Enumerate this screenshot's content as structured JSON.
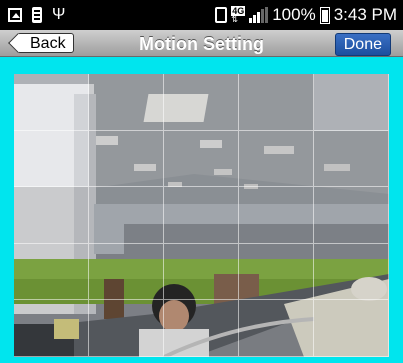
{
  "status_bar": {
    "battery": "100%",
    "time": "3:43 PM",
    "network": "4G",
    "icons": [
      "gallery-icon",
      "sd-card-icon",
      "usb-icon",
      "vibrate-icon",
      "lte-icon",
      "signal-icon",
      "battery-icon"
    ]
  },
  "nav": {
    "back_label": "Back",
    "title": "Motion Setting",
    "done_label": "Done"
  },
  "motion_grid": {
    "columns": 5,
    "rows": 5,
    "cells": [
      [
        false,
        true,
        true,
        true,
        false
      ],
      [
        false,
        true,
        true,
        true,
        true
      ],
      [
        true,
        true,
        true,
        true,
        true
      ],
      [
        true,
        true,
        true,
        true,
        true
      ],
      [
        true,
        true,
        true,
        true,
        true
      ]
    ]
  },
  "colors": {
    "frame_border": "#00e5ee",
    "done_button": "#1c4f9e",
    "nav_bar": "#b0b0b0"
  }
}
